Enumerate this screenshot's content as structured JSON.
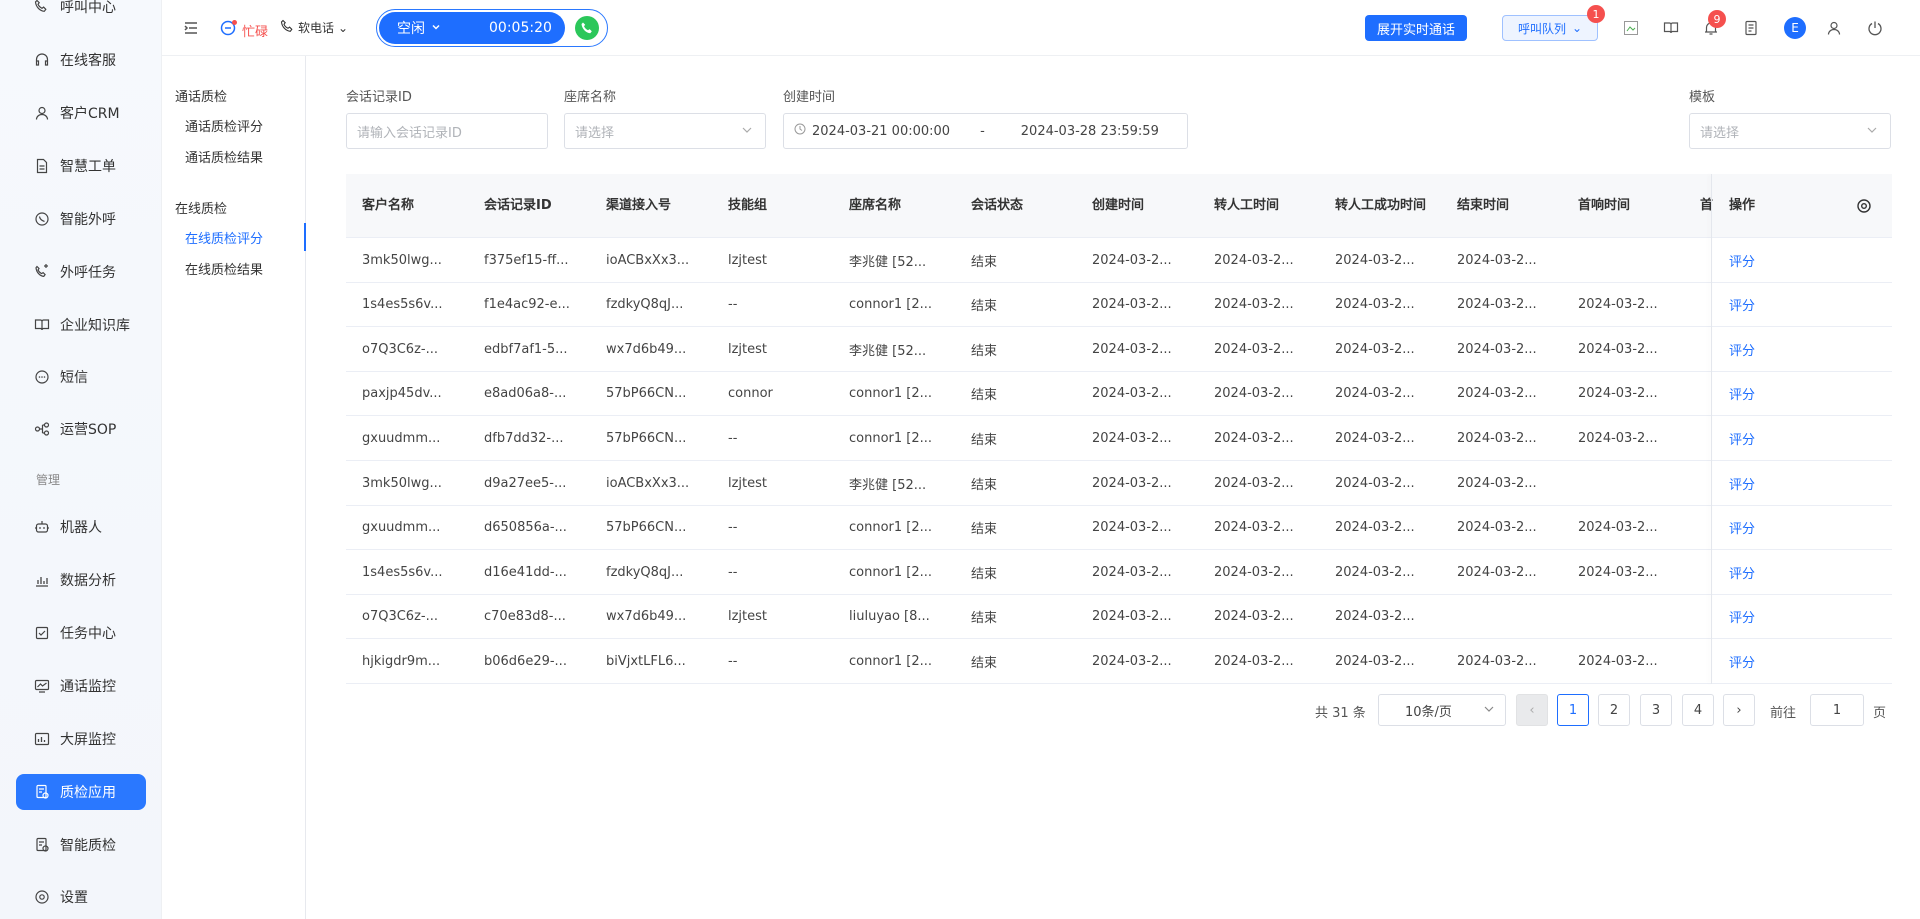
{
  "sidebar": {
    "items": [
      {
        "label": "呼叫中心",
        "icon": "phone-icon"
      },
      {
        "label": "在线客服",
        "icon": "headset-icon"
      },
      {
        "label": "客户CRM",
        "icon": "user-icon"
      },
      {
        "label": "智慧工单",
        "icon": "ticket-icon"
      },
      {
        "label": "智能外呼",
        "icon": "whatsapp-icon"
      },
      {
        "label": "外呼任务",
        "icon": "phone-task-icon"
      },
      {
        "label": "企业知识库",
        "icon": "book-icon"
      },
      {
        "label": "短信",
        "icon": "sms-icon"
      },
      {
        "label": "运营SOP",
        "icon": "flow-icon"
      }
    ],
    "section_label": "管理",
    "manage_items": [
      {
        "label": "机器人",
        "icon": "robot-icon"
      },
      {
        "label": "数据分析",
        "icon": "bar-chart-icon"
      },
      {
        "label": "任务中心",
        "icon": "task-icon"
      },
      {
        "label": "通话监控",
        "icon": "monitor-icon"
      },
      {
        "label": "大屏监控",
        "icon": "dashboard-icon"
      },
      {
        "label": "质检应用",
        "icon": "qc-app-icon",
        "active": true
      },
      {
        "label": "智能质检",
        "icon": "smart-qc-icon"
      },
      {
        "label": "设置",
        "icon": "settings-icon"
      }
    ]
  },
  "topbar": {
    "status_label": "忙碌",
    "phone_mode": "软电话",
    "call_state": "空闲",
    "call_timer": "00:05:20",
    "realtime_button": "展开实时通话",
    "queue_label": "呼叫队列",
    "queue_badge": "1",
    "notify_badge": "9",
    "avatar_letter": "E"
  },
  "subnav": {
    "group1": "通话质检",
    "group1_items": [
      "通话质检评分",
      "通话质检结果"
    ],
    "group2": "在线质检",
    "group2_items": [
      "在线质检评分",
      "在线质检结果"
    ]
  },
  "filters": {
    "session_id_label": "会话记录ID",
    "session_id_placeholder": "请输入会话记录ID",
    "agent_label": "座席名称",
    "agent_placeholder": "请选择",
    "created_label": "创建时间",
    "created_start": "2024-03-21 00:00:00",
    "created_sep": "-",
    "created_end": "2024-03-28 23:59:59",
    "template_label": "模板",
    "template_placeholder": "请选择"
  },
  "table": {
    "columns": [
      "客户名称",
      "会话记录ID",
      "渠道接入号",
      "技能组",
      "座席名称",
      "会话状态",
      "创建时间",
      "转人工时间",
      "转人工成功时间",
      "结束时间",
      "首响时间",
      "首",
      "操作"
    ],
    "rows": [
      [
        "3mk50lwg...",
        "f375ef15-ff...",
        "ioACBxXx3...",
        "lzjtest",
        "李兆健 [52...",
        "结束",
        "2024-03-2...",
        "2024-03-2...",
        "2024-03-2...",
        "2024-03-2...",
        "",
        "评分"
      ],
      [
        "1s4es5s6v...",
        "f1e4ac92-e...",
        "fzdkyQ8qJ...",
        "--",
        "connor1 [2...",
        "结束",
        "2024-03-2...",
        "2024-03-2...",
        "2024-03-2...",
        "2024-03-2...",
        "2024-03-2...",
        "评分"
      ],
      [
        "o7Q3C6z-...",
        "edbf7af1-5...",
        "wx7d6b49...",
        "lzjtest",
        "李兆健 [52...",
        "结束",
        "2024-03-2...",
        "2024-03-2...",
        "2024-03-2...",
        "2024-03-2...",
        "2024-03-2...",
        "评分"
      ],
      [
        "paxjp45dv...",
        "e8ad06a8-...",
        "57bP66CN...",
        "connor",
        "connor1 [2...",
        "结束",
        "2024-03-2...",
        "2024-03-2...",
        "2024-03-2...",
        "2024-03-2...",
        "2024-03-2...",
        "评分"
      ],
      [
        "gxuudmm...",
        "dfb7dd32-...",
        "57bP66CN...",
        "--",
        "connor1 [2...",
        "结束",
        "2024-03-2...",
        "2024-03-2...",
        "2024-03-2...",
        "2024-03-2...",
        "2024-03-2...",
        "评分"
      ],
      [
        "3mk50lwg...",
        "d9a27ee5-...",
        "ioACBxXx3...",
        "lzjtest",
        "李兆健 [52...",
        "结束",
        "2024-03-2...",
        "2024-03-2...",
        "2024-03-2...",
        "2024-03-2...",
        "",
        "评分"
      ],
      [
        "gxuudmm...",
        "d650856a-...",
        "57bP66CN...",
        "--",
        "connor1 [2...",
        "结束",
        "2024-03-2...",
        "2024-03-2...",
        "2024-03-2...",
        "2024-03-2...",
        "2024-03-2...",
        "评分"
      ],
      [
        "1s4es5s6v...",
        "d16e41dd-...",
        "fzdkyQ8qJ...",
        "--",
        "connor1 [2...",
        "结束",
        "2024-03-2...",
        "2024-03-2...",
        "2024-03-2...",
        "2024-03-2...",
        "2024-03-2...",
        "评分"
      ],
      [
        "o7Q3C6z-...",
        "c70e83d8-...",
        "wx7d6b49...",
        "lzjtest",
        "liuluyao [8...",
        "结束",
        "2024-03-2...",
        "2024-03-2...",
        "2024-03-2...",
        "",
        "",
        "评分"
      ],
      [
        "hjkigdr9m...",
        "b06d6e29-...",
        "biVjxtLFL6...",
        "--",
        "connor1 [2...",
        "结束",
        "2024-03-2...",
        "2024-03-2...",
        "2024-03-2...",
        "2024-03-2...",
        "2024-03-2...",
        "评分"
      ]
    ]
  },
  "pagination": {
    "total": "共 31 条",
    "page_size": "10条/页",
    "pages": [
      "1",
      "2",
      "3",
      "4"
    ],
    "current": "1",
    "goto_label": "前往",
    "goto_value": "1",
    "page_suffix": "页"
  },
  "colors": {
    "accent": "#1e6eff",
    "busy": "#f5504e",
    "call_green": "#2bc75a"
  }
}
